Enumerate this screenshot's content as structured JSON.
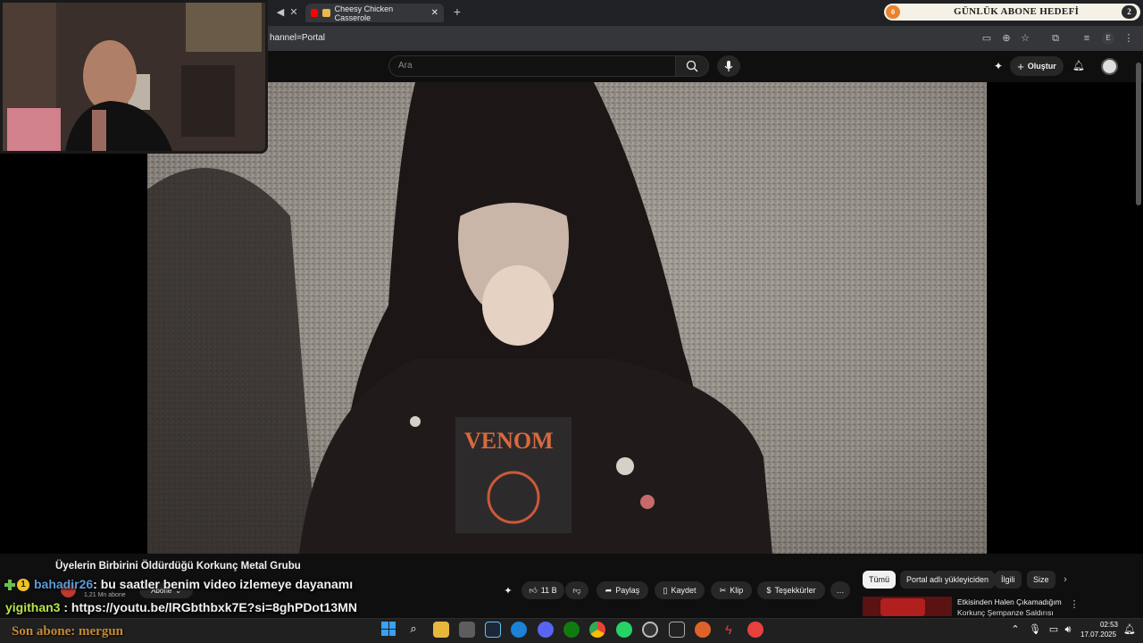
{
  "browser": {
    "tabs": [
      {
        "label": "Cheesy Chicken Casserole"
      }
    ],
    "new_tab": "+",
    "url_fragment": "hannel=Portal",
    "profile": "E"
  },
  "youtube": {
    "search_placeholder": "Ara",
    "create_label": "Oluştur"
  },
  "video": {
    "title": "Üyelerin Birbirini Öldürdüğü Korkunç Metal Grubu",
    "channel_subs": "1,21 Mn abone",
    "subscribe_label": "Abone",
    "likes": "11 B",
    "actions": [
      "Paylaş",
      "Kaydet",
      "Klip",
      "Teşekkürler"
    ],
    "more": "…"
  },
  "sidebar": {
    "chips": [
      "Tümü",
      "Portal adlı yükleyiciden",
      "İlgili",
      "Size"
    ],
    "next_video": {
      "title": "Etkisinden Halen Çıkamadığım",
      "subtitle": "Korkunç Şempanze Saldırısı"
    }
  },
  "overlay": {
    "goal_label": "GÜNLÜK ABONE HEDEFİ",
    "goal_current": "0",
    "goal_target": "2",
    "chat": [
      {
        "user": "bahadir26",
        "text": ": bu saatler benim video izlemeye dayanamı"
      },
      {
        "user": "yigithan3",
        "text": " : https://youtu.be/lRGbthbxk7E?si=8ghPDot13MN"
      }
    ],
    "badge": "1",
    "last_sub": "Son abone: mergun"
  },
  "taskbar": {
    "time": "02:53",
    "date": "17.07.2025"
  },
  "colors": {
    "accent": "#ff0000",
    "user1": "#5b9bd5",
    "user2": "#b7e34a",
    "gold": "#c58a35"
  }
}
